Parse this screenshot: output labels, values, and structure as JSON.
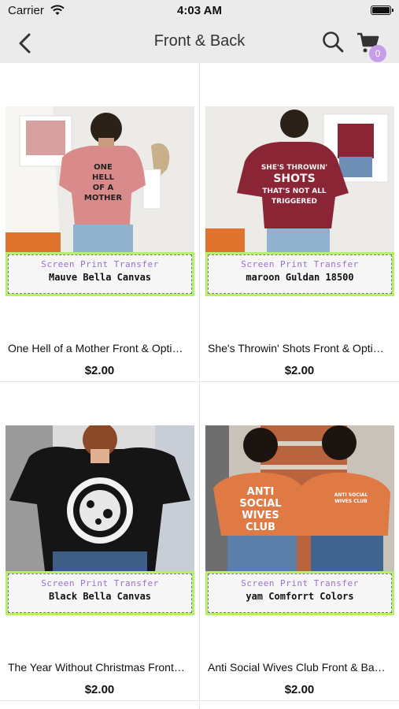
{
  "status": {
    "carrier": "Carrier",
    "time": "4:03 AM"
  },
  "nav": {
    "title": "Front & Back",
    "cart_count": "0"
  },
  "products": [
    {
      "title": "One Hell of a Mother Front & Opti…",
      "price": "$2.00",
      "label_top": "Screen Print Transfer",
      "label_bottom": "Mauve Bella Canvas",
      "shirt_color": "#d98b8b"
    },
    {
      "title": "She's Throwin' Shots Front & Opti…",
      "price": "$2.00",
      "label_top": "Screen Print Transfer",
      "label_bottom": "maroon Guldan 18500",
      "shirt_color": "#8a2536"
    },
    {
      "title": "The Year Without Christmas Front…",
      "price": "$2.00",
      "label_top": "Screen Print Transfer",
      "label_bottom": "Black Bella Canvas",
      "shirt_color": "#151515"
    },
    {
      "title": "Anti Social Wives Club Front & Ba…",
      "price": "$2.00",
      "label_top": "Screen Print Transfer",
      "label_bottom": "yam Comforrt Colors",
      "shirt_color": "#e07a45"
    }
  ],
  "colors": {
    "accent_badge": "#c79ce8",
    "label_green": "#b6f06a",
    "label_purple": "#9b6fd0"
  }
}
